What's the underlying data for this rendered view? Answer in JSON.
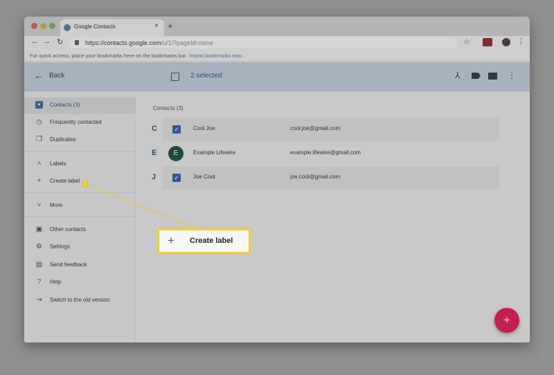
{
  "browser": {
    "tab_title": "Google Contacts",
    "tab_close": "×",
    "new_tab": "+",
    "url_host": "https://contacts.google.com",
    "url_path": "/u/1/?pageId=none",
    "bookmarks_prompt": "For quick access, place your bookmarks here on the bookmarks bar.",
    "bookmarks_import": "Import bookmarks now...",
    "icons": {
      "back": "arrow-left-icon",
      "forward": "arrow-right-icon",
      "reload": "reload-icon",
      "star": "star-icon",
      "menu": "vertical-dots-icon"
    }
  },
  "appbar": {
    "back_label": "Back",
    "selected_label": "2 selected"
  },
  "sidebar": {
    "items": [
      {
        "label": "Contacts (3)",
        "icon": "contacts-icon"
      },
      {
        "label": "Frequently contacted",
        "icon": "history-icon"
      },
      {
        "label": "Duplicates",
        "icon": "duplicates-icon"
      },
      {
        "label": "Labels",
        "icon": "chevron-up-icon"
      },
      {
        "label": "Create label",
        "icon": "plus-icon"
      },
      {
        "label": "More",
        "icon": "chevron-down-icon"
      },
      {
        "label": "Other contacts",
        "icon": "add-contact-icon"
      },
      {
        "label": "Settings",
        "icon": "gear-icon"
      },
      {
        "label": "Send feedback",
        "icon": "feedback-icon"
      },
      {
        "label": "Help",
        "icon": "help-icon"
      },
      {
        "label": "Switch to the old version",
        "icon": "exit-icon"
      }
    ]
  },
  "main": {
    "heading": "Contacts (3)",
    "contacts": [
      {
        "letter": "C",
        "name": "Cool Joe",
        "email": "cool.joe@gmail.com",
        "selected": true
      },
      {
        "letter": "E",
        "name": "Example Lifewire",
        "email": "example.lifewire@gmail.com",
        "selected": false,
        "avatar": "E"
      },
      {
        "letter": "J",
        "name": "Joe Cool",
        "email": "joe.cool@gmail.com",
        "selected": true
      }
    ]
  },
  "callout": {
    "label": "Create label",
    "plus": "+"
  },
  "fab": {
    "label": "+"
  },
  "colors": {
    "accent": "#2f5a8a",
    "callout_border": "#f2cf2d",
    "fab": "#c41f4f"
  }
}
